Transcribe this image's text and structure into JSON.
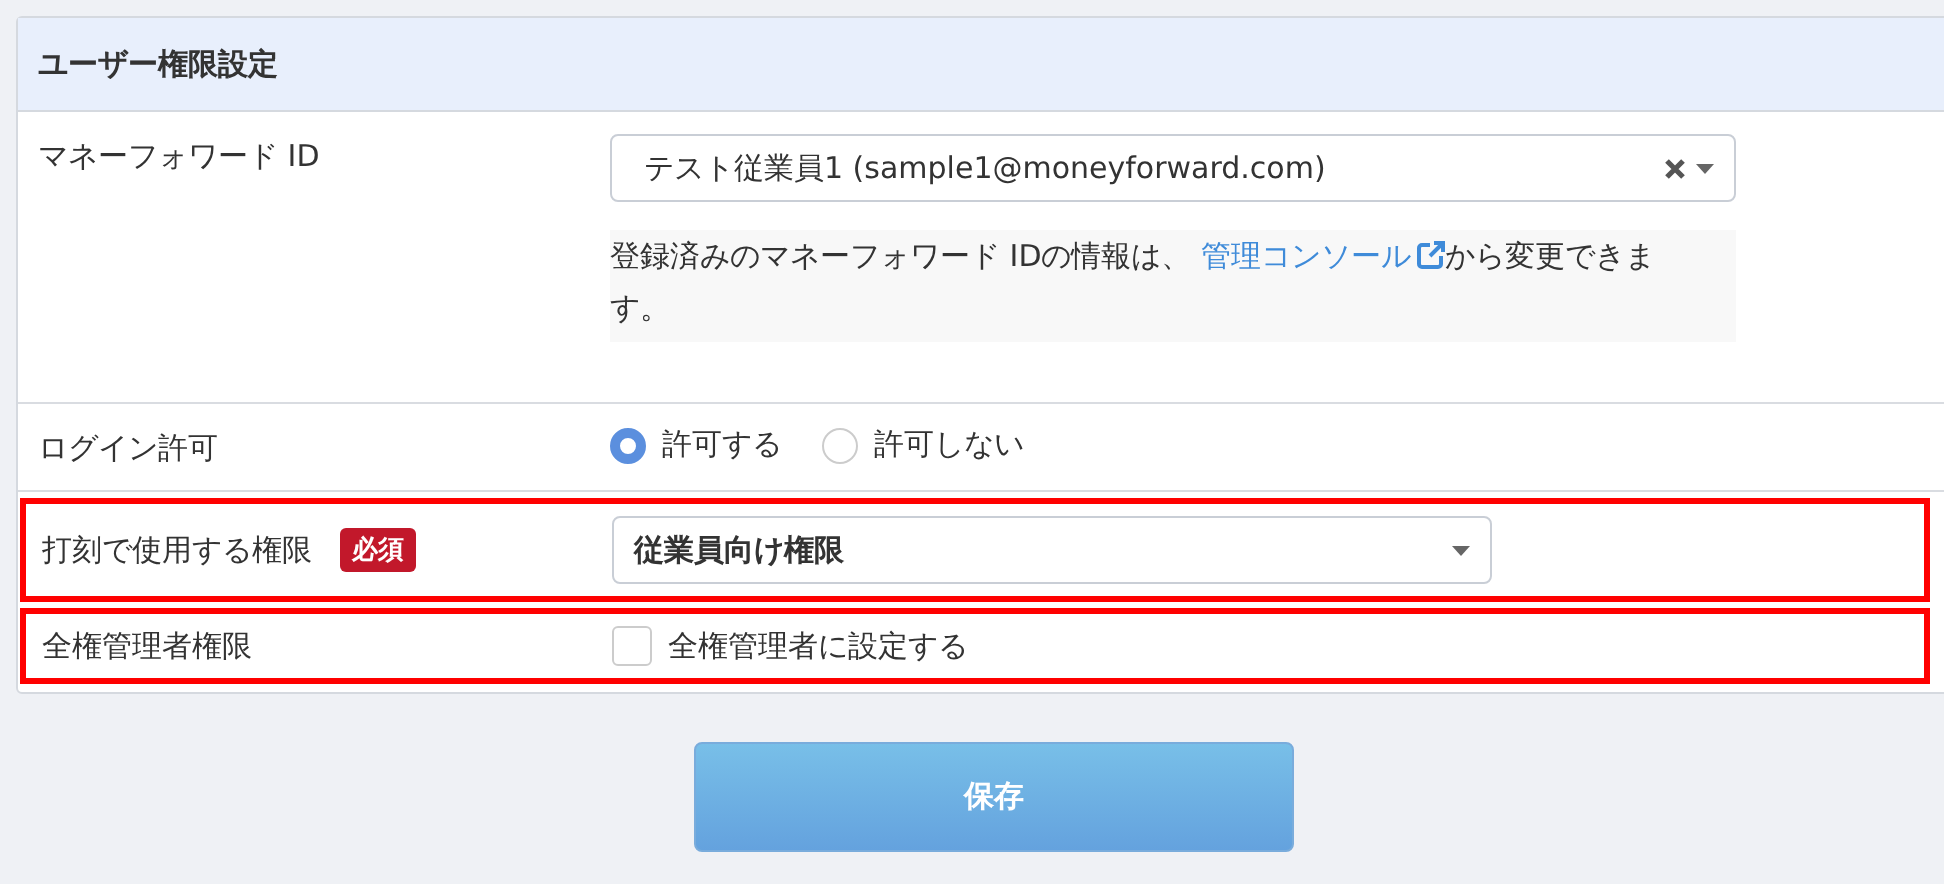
{
  "panel": {
    "title": "ユーザー権限設定"
  },
  "rows": [
    {
      "kind": "select",
      "label": "マネーフォワード ID",
      "highlighted": false,
      "value": "テスト従業員1 (sample1@moneyforward.com)",
      "clearable": true,
      "help": {
        "text": "登録済みのマネーフォワード IDの情報は、 ",
        "link": "管理コンソール",
        "after": "から変更できます。"
      }
    },
    {
      "kind": "radio",
      "label": "ログイン許可",
      "highlighted": false,
      "options": [
        {
          "label": "許可する",
          "selected": true
        },
        {
          "label": "許可しない",
          "selected": false
        }
      ]
    },
    {
      "kind": "select",
      "label": "打刻で使用する権限",
      "required_badge": "必須",
      "highlighted": true,
      "value": "従業員向け権限",
      "clearable": false
    },
    {
      "kind": "checkbox",
      "label": "全権管理者権限",
      "highlighted": true,
      "option": "全権管理者に設定する",
      "checked": false
    }
  ],
  "save_button": "保存"
}
